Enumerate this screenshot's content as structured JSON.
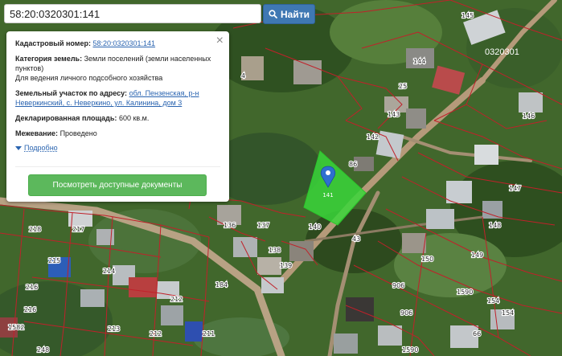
{
  "search": {
    "value": "58:20:0320301:141",
    "button_label": "Найти"
  },
  "card": {
    "cadastral_label": "Кадастровый номер:",
    "cadastral_value": "58:20:0320301:141",
    "category_label": "Категория земель:",
    "category_value": "Земли поселений (земли населенных пунктов)",
    "usage_value": "Для ведения личного подсобного хозяйства",
    "address_label": "Земельный участок по адресу:",
    "address_value": "обл. Пензенская, р-н Неверкинский, с. Неверкино, ул. Калинина, дом 3",
    "area_label": "Декларированная площадь:",
    "area_value": "600 кв.м.",
    "survey_label": "Межевание:",
    "survey_value": "Проведено",
    "more_label": "Подробно",
    "docs_button": "Посмотреть доступные документы",
    "close_symbol": "×"
  },
  "map": {
    "quarter_label": "0320301",
    "marker_label": "141",
    "parcels": [
      {
        "label": "145"
      },
      {
        "label": "144"
      },
      {
        "label": "25"
      },
      {
        "label": "4"
      },
      {
        "label": "143"
      },
      {
        "label": "142"
      },
      {
        "label": "146"
      },
      {
        "label": "86"
      },
      {
        "label": "147"
      },
      {
        "label": "148"
      },
      {
        "label": "218"
      },
      {
        "label": "217"
      },
      {
        "label": "136"
      },
      {
        "label": "137"
      },
      {
        "label": "140"
      },
      {
        "label": "43"
      },
      {
        "label": "215"
      },
      {
        "label": "214"
      },
      {
        "label": "138"
      },
      {
        "label": "139"
      },
      {
        "label": "150"
      },
      {
        "label": "149"
      },
      {
        "label": "216"
      },
      {
        "label": "184"
      },
      {
        "label": "906"
      },
      {
        "label": "1590"
      },
      {
        "label": "154"
      },
      {
        "label": "212"
      },
      {
        "label": "216"
      },
      {
        "label": "213"
      },
      {
        "label": "212"
      },
      {
        "label": "211"
      },
      {
        "label": "906"
      },
      {
        "label": "154"
      },
      {
        "label": "66"
      },
      {
        "label": "248"
      },
      {
        "label": "1590"
      },
      {
        "label": "1582"
      }
    ]
  },
  "colors": {
    "search_button": "#3f78b3",
    "docs_button": "#5cb85c",
    "highlight": "#39d639",
    "boundary": "#c0212a",
    "link": "#2a64b0"
  }
}
